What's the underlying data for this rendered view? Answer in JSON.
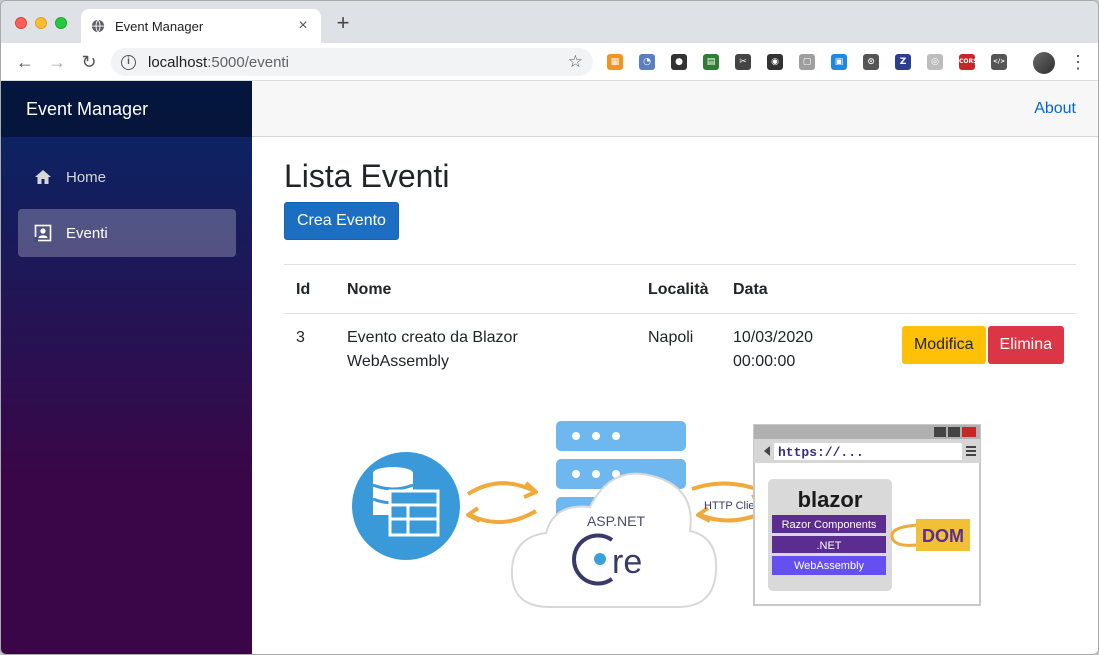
{
  "browser": {
    "tab_title": "Event Manager",
    "url_host": "localhost",
    "url_path": ":5000/eventi",
    "extensions": [
      {
        "name": "orange-ext-icon",
        "color": "#f29421",
        "glyph": "▦"
      },
      {
        "name": "blue-circle-ext-icon",
        "color": "#5a7ec2",
        "glyph": "◔"
      },
      {
        "name": "dark-circle-ext-icon",
        "color": "#333333",
        "glyph": "●"
      },
      {
        "name": "sheet-ext-icon",
        "color": "#2e7d32",
        "glyph": "▤"
      },
      {
        "name": "scissors-ext-icon",
        "color": "#444444",
        "glyph": "✂"
      },
      {
        "name": "eye-ext-icon",
        "color": "#333333",
        "glyph": "◉"
      },
      {
        "name": "comment-ext-icon",
        "color": "#9e9e9e",
        "glyph": "▢"
      },
      {
        "name": "window-ext-icon",
        "color": "#1e88e5",
        "glyph": "▣"
      },
      {
        "name": "braces-ext-icon",
        "color": "#555555",
        "glyph": "⊙"
      },
      {
        "name": "z-ext-icon",
        "color": "#2c3e8f",
        "glyph": "Z"
      },
      {
        "name": "target-ext-icon",
        "color": "#bdbdbd",
        "glyph": "◎"
      },
      {
        "name": "cors-ext-icon",
        "color": "#c62828",
        "glyph": "CORS"
      },
      {
        "name": "code-ext-icon",
        "color": "#555555",
        "glyph": "</>"
      }
    ]
  },
  "app": {
    "brand": "Event Manager",
    "nav": [
      {
        "label": "Home",
        "icon": "home-icon"
      },
      {
        "label": "Eventi",
        "icon": "contact-card-icon",
        "active": true
      }
    ],
    "about_label": "About",
    "page_title": "Lista Eventi",
    "create_button": "Crea Evento",
    "table": {
      "headers": [
        "Id",
        "Nome",
        "Località",
        "Data"
      ],
      "rows": [
        {
          "id": "3",
          "nome_line1": "Evento creato da Blazor",
          "nome_line2": "WebAssembly",
          "localita": "Napoli",
          "data_line1": "10/03/2020",
          "data_line2": "00:00:00",
          "edit_label": "Modifica",
          "delete_label": "Elimina"
        }
      ]
    },
    "diagram": {
      "aspnet_label": "ASP.NET",
      "core_label": "re",
      "http_client_label": "HTTP Client",
      "blazor_label": "blazor",
      "browser_url": "https://...",
      "stack": [
        "Razor Components",
        ".NET",
        "WebAssembly"
      ],
      "dom_label": "DOM"
    }
  },
  "colors": {
    "primary": "#1b6ec2",
    "warning": "#ffc107",
    "danger": "#dc3545",
    "sidebar_top": "#052767",
    "sidebar_bottom": "#3a0647",
    "link": "#0366d6"
  }
}
